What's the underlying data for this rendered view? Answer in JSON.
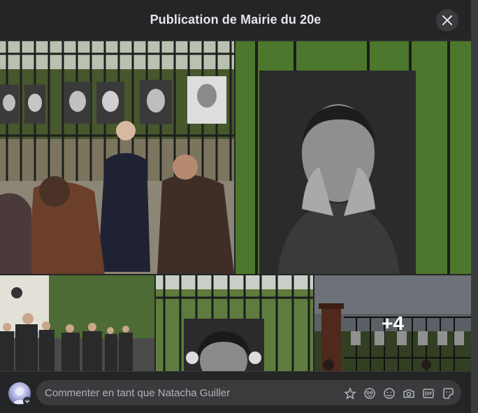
{
  "header": {
    "title": "Publication de Mairie du 20e",
    "close_icon": "close-icon"
  },
  "gallery": {
    "photos": [
      {
        "name": "photo-group-at-fence",
        "description_icon": "photo"
      },
      {
        "name": "photo-portrait-hands-on-face",
        "description_icon": "photo"
      },
      {
        "name": "photo-street-crowd",
        "description_icon": "photo"
      },
      {
        "name": "photo-portrait-girl-behind-fence",
        "description_icon": "photo"
      },
      {
        "name": "photo-park-exhibition",
        "description_icon": "photo"
      }
    ],
    "more_count_label": "+4"
  },
  "composer": {
    "placeholder": "Commenter en tant que Natacha Guiller",
    "tools": [
      "avatar-sticker-icon",
      "emoji-face-icon",
      "smiley-icon",
      "camera-icon",
      "gif-icon",
      "sticker-icon"
    ]
  },
  "colors": {
    "background": "#242526",
    "input": "#3a3b3c",
    "text": "#e4e6eb",
    "muted": "#b0b3b8"
  }
}
